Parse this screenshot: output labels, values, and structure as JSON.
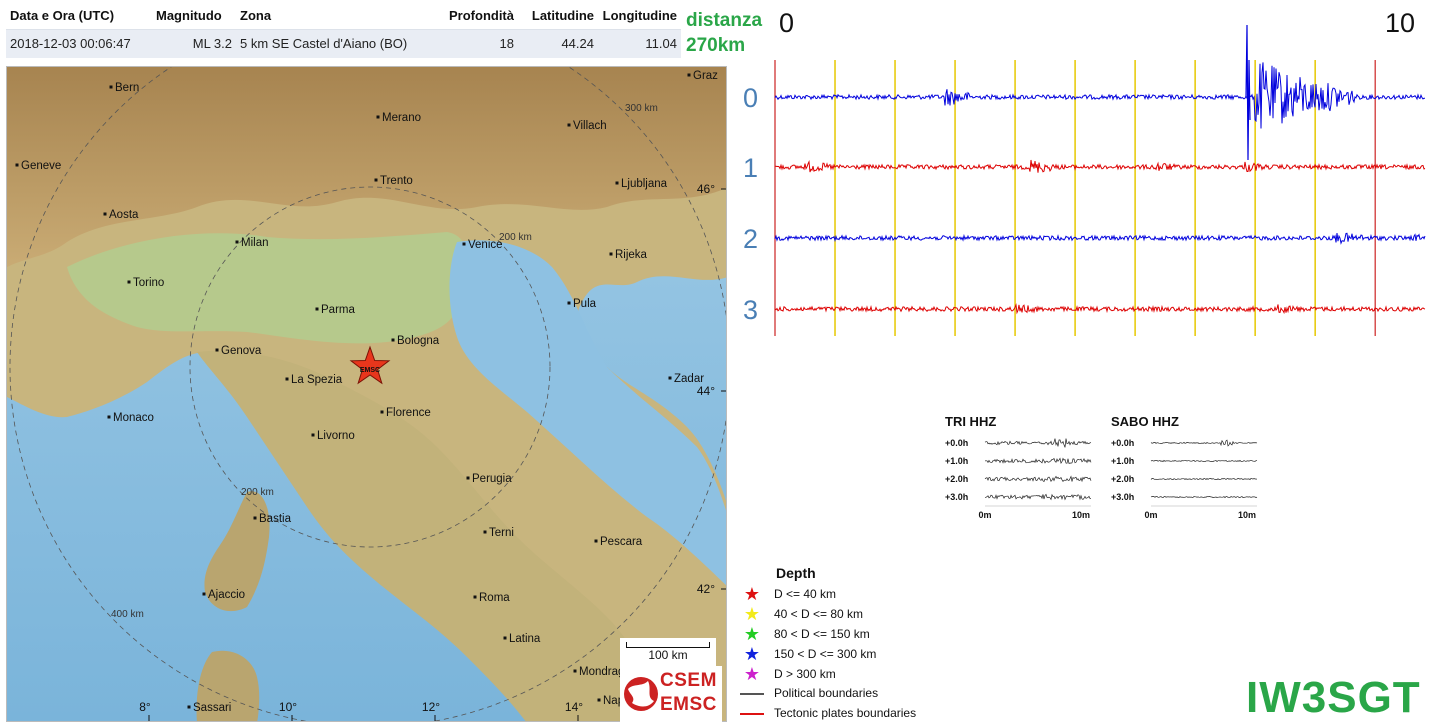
{
  "event_table": {
    "headers": {
      "datetime": "Data e Ora (UTC)",
      "magnitude": "Magnitudo",
      "zone": "Zona",
      "depth": "Profondità",
      "latitude": "Latitudine",
      "longitude": "Longitudine"
    },
    "row": {
      "datetime": "2018-12-03 00:06:47",
      "magnitude": "ML 3.2",
      "zone": "5 km SE Castel d'Aiano (BO)",
      "depth": "18",
      "latitude": "44.24",
      "longitude": "11.04"
    }
  },
  "map": {
    "cities": [
      {
        "name": "Bern"
      },
      {
        "name": "Graz"
      },
      {
        "name": "Merano"
      },
      {
        "name": "Villach"
      },
      {
        "name": "Geneve"
      },
      {
        "name": "Trento"
      },
      {
        "name": "Ljubljana"
      },
      {
        "name": "Aosta"
      },
      {
        "name": "Milan"
      },
      {
        "name": "Venice"
      },
      {
        "name": "Rijeka"
      },
      {
        "name": "Torino"
      },
      {
        "name": "Parma"
      },
      {
        "name": "Pula"
      },
      {
        "name": "Bologna"
      },
      {
        "name": "Genova"
      },
      {
        "name": "La Spezia"
      },
      {
        "name": "Zadar"
      },
      {
        "name": "Monaco"
      },
      {
        "name": "Florence"
      },
      {
        "name": "Livorno"
      },
      {
        "name": "Perugia"
      },
      {
        "name": "Bastia"
      },
      {
        "name": "Terni"
      },
      {
        "name": "Pescara"
      },
      {
        "name": "Ajaccio"
      },
      {
        "name": "Roma"
      },
      {
        "name": "Latina"
      },
      {
        "name": "Mondrag"
      },
      {
        "name": "Sassari"
      },
      {
        "name": "Nap"
      }
    ],
    "range_labels": [
      "300 km",
      "200 km",
      "200 km",
      "400 km"
    ],
    "lat_ticks": [
      "46°",
      "44°",
      "42°"
    ],
    "lon_ticks": [
      "8°",
      "10°",
      "12°",
      "14°"
    ],
    "epicenter_label": "EMSC",
    "scale_bar": "100 km",
    "logo_top": "CSEM",
    "logo_bottom": "EMSC"
  },
  "distance": {
    "label": "distanza",
    "value": "270km"
  },
  "seismogram": {
    "axis_start": "0",
    "axis_end": "10",
    "traces": [
      {
        "label": "0",
        "color": "#0000dd"
      },
      {
        "label": "1",
        "color": "#dd0000"
      },
      {
        "label": "2",
        "color": "#0000dd"
      },
      {
        "label": "3",
        "color": "#dd0000"
      }
    ]
  },
  "mini_seismograms": [
    {
      "title": "TRI HHZ",
      "rows": [
        "+0.0h",
        "+1.0h",
        "+2.0h",
        "+3.0h"
      ],
      "x_start": "0m",
      "x_end": "10m"
    },
    {
      "title": "SABO HHZ",
      "rows": [
        "+0.0h",
        "+1.0h",
        "+2.0h",
        "+3.0h"
      ],
      "x_start": "0m",
      "x_end": "10m"
    }
  ],
  "legend": {
    "title": "Depth",
    "items": [
      {
        "label": "D <= 40 km",
        "color": "#dd1111"
      },
      {
        "label": "40 < D <= 80 km",
        "color": "#f2ea1a"
      },
      {
        "label": "80 < D <= 150 km",
        "color": "#22cc22"
      },
      {
        "label": "150 < D <= 300 km",
        "color": "#1122dd"
      },
      {
        "label": "D > 300 km",
        "color": "#cc22cc"
      }
    ],
    "lines": [
      {
        "label": "Political boundaries",
        "color": "#555555"
      },
      {
        "label": "Tectonic plates boundaries",
        "color": "#dd1111"
      }
    ]
  },
  "callsign": "IW3SGT"
}
